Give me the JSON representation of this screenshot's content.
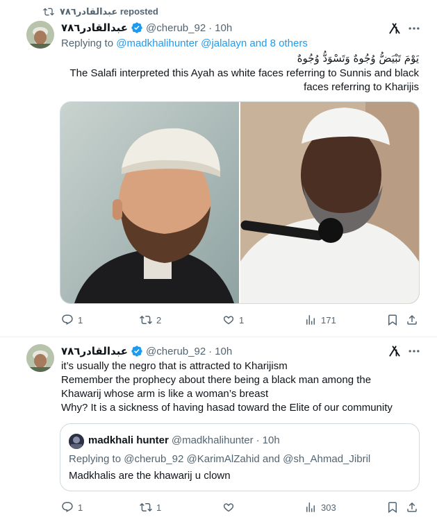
{
  "repost": {
    "text": "عبدالقادر٧٨٦ reposted"
  },
  "tweet1": {
    "display_name": "عبدالقادر٧٨٦",
    "handle": "@cherub_92",
    "dot": "·",
    "time": "10h",
    "replying_prefix": "Replying to",
    "replying_users": "@madkhalihunter @jalalayn and 8 others",
    "arabic_line": "يَوْمَ تَبْيَضُّ وُجُوهٌ وَتَسْوَدُّ وُجُوهٌ",
    "text_line1": "The Salafi interpreted this Ayah as white faces referring to Sunnis and black",
    "text_line2": "faces referring to Kharijis",
    "stats": {
      "replies": "1",
      "reposts": "2",
      "likes": "1",
      "views": "171"
    }
  },
  "tweet2": {
    "display_name": "عبدالقادر٧٨٦",
    "handle": "@cherub_92",
    "dot": "·",
    "time": "10h",
    "lines": [
      "it’s usually the negro that is attracted to Kharijism",
      "Remember the prophecy about there being a black man among the",
      "Khawarij whose arm is like a woman’s breast",
      "Why? It is a sickness of having hasad toward the Elite of our community"
    ],
    "quote": {
      "display_name": "madkhali hunter",
      "handle": "@madkhalihunter",
      "dot": "·",
      "time": "10h",
      "replying": "Replying to @cherub_92 @KarimAlZahid and @sh_Ahmad_Jibril",
      "text": "Madkhalis are the khawarij u clown"
    },
    "stats": {
      "replies": "1",
      "reposts": "1",
      "likes": "",
      "views": "303"
    }
  },
  "colors": {
    "accent": "#1d9bf0",
    "muted": "#536471",
    "border": "#cfd9de"
  }
}
